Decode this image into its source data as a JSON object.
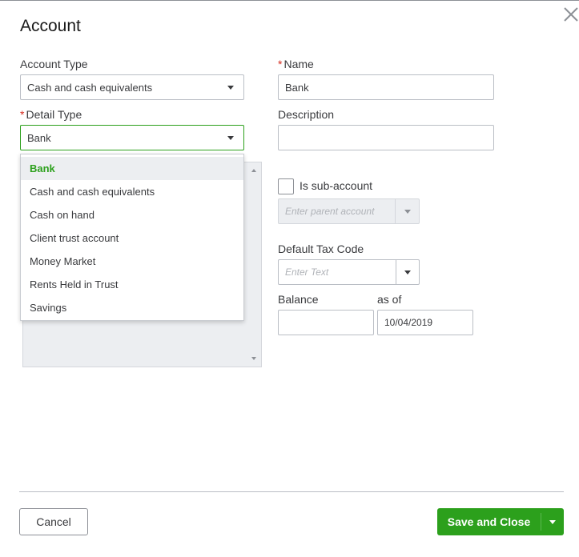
{
  "dialog": {
    "title": "Account"
  },
  "account_type": {
    "label": "Account Type",
    "value": "Cash and cash equivalents"
  },
  "detail_type": {
    "required_mark": "*",
    "label": "Detail Type",
    "value": "Bank",
    "options": [
      "Bank",
      "Cash and cash equivalents",
      "Cash on hand",
      "Client trust account",
      "Money Market",
      "Rents Held in Trust",
      "Savings"
    ],
    "selected_index": 0
  },
  "name": {
    "required_mark": "*",
    "label": "Name",
    "value": "Bank"
  },
  "description": {
    "label": "Description",
    "value": ""
  },
  "sub_account": {
    "label": "Is sub-account",
    "checked": false,
    "parent_placeholder": "Enter parent account"
  },
  "tax_code": {
    "label": "Default Tax Code",
    "placeholder": "Enter Text"
  },
  "balance": {
    "label": "Balance",
    "value": "",
    "as_of_label": "as of",
    "as_of_value": "10/04/2019"
  },
  "footer": {
    "cancel_label": "Cancel",
    "save_label": "Save and Close"
  },
  "colors": {
    "accent_green": "#2ca01c",
    "required_red": "#d52b1e",
    "disabled_bg": "#eceef1"
  },
  "icons": {
    "close": "close-icon",
    "dropdown": "chevron-down-icon"
  }
}
